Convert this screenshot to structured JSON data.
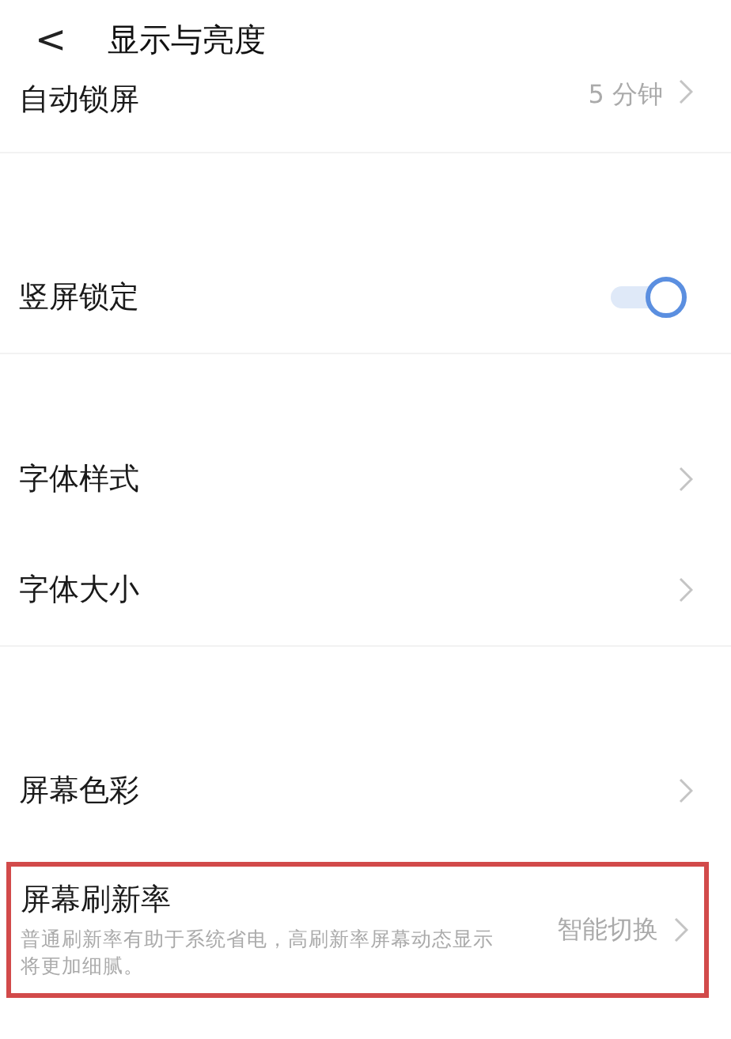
{
  "header": {
    "back": "<",
    "title": "显示与亮度"
  },
  "groups": [
    {
      "items": [
        {
          "kind": "link",
          "label": "自动锁屏",
          "value": "5 分钟",
          "highlighted": false
        }
      ]
    },
    {
      "items": [
        {
          "kind": "toggle",
          "label": "竖屏锁定",
          "on": true,
          "highlighted": false
        }
      ]
    },
    {
      "items": [
        {
          "kind": "link",
          "label": "字体样式",
          "highlighted": false
        },
        {
          "kind": "link",
          "label": "字体大小",
          "highlighted": false
        }
      ]
    },
    {
      "items": [
        {
          "kind": "link",
          "label": "屏幕色彩",
          "highlighted": false
        },
        {
          "kind": "link",
          "label": "屏幕刷新率",
          "description": "普通刷新率有助于系统省电，高刷新率屏幕动态显示将更加细腻。",
          "value": "智能切换",
          "highlighted": true
        }
      ]
    }
  ]
}
